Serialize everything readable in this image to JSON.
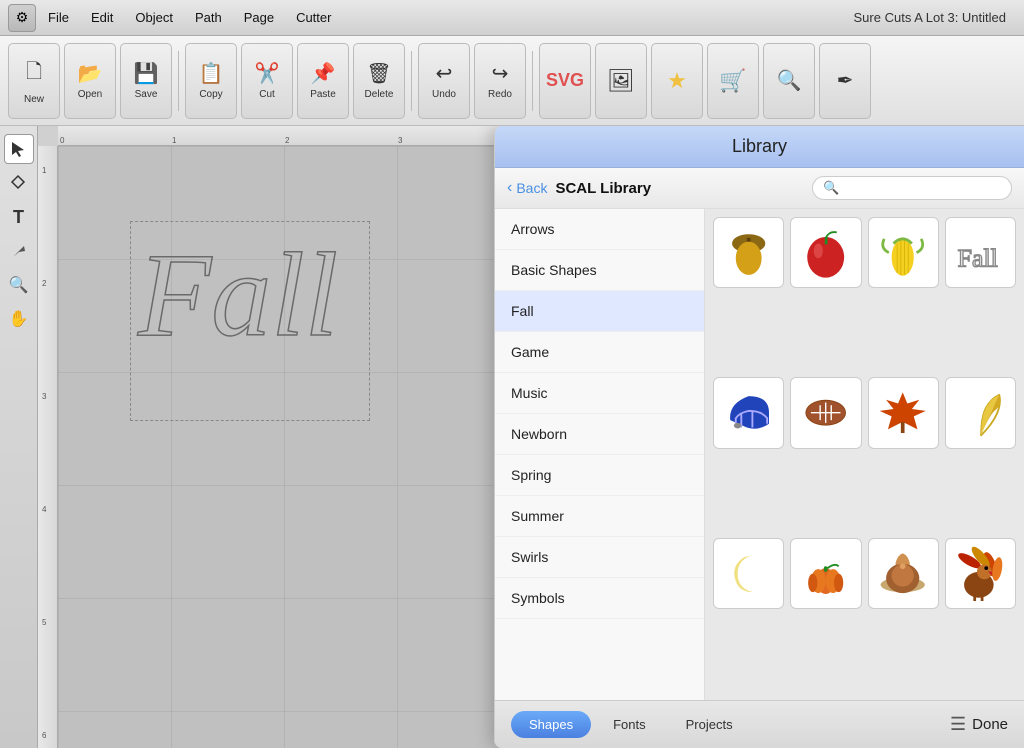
{
  "app": {
    "title": "Sure Cuts A Lot 3: Untitled"
  },
  "menubar": {
    "items": [
      "File",
      "Edit",
      "Object",
      "Path",
      "Page",
      "Cutter"
    ]
  },
  "toolbar": {
    "buttons": [
      {
        "label": "New",
        "icon": "🗋"
      },
      {
        "label": "Open",
        "icon": "📂"
      },
      {
        "label": "Save",
        "icon": "💾"
      },
      {
        "label": "Copy",
        "icon": "📋"
      },
      {
        "label": "Cut",
        "icon": "✂️"
      },
      {
        "label": "Paste",
        "icon": "📌"
      },
      {
        "label": "Delete",
        "icon": "🗑"
      },
      {
        "label": "Undo",
        "icon": "↩"
      },
      {
        "label": "Redo",
        "icon": "↪"
      }
    ]
  },
  "library": {
    "title": "Library",
    "back_label": "Back",
    "section_title": "SCAL Library",
    "search_placeholder": "",
    "categories": [
      {
        "id": "arrows",
        "label": "Arrows",
        "active": false
      },
      {
        "id": "basic-shapes",
        "label": "Basic Shapes",
        "active": false
      },
      {
        "id": "fall",
        "label": "Fall",
        "active": true
      },
      {
        "id": "game",
        "label": "Game",
        "active": false
      },
      {
        "id": "music",
        "label": "Music",
        "active": false
      },
      {
        "id": "newborn",
        "label": "Newborn",
        "active": false
      },
      {
        "id": "spring",
        "label": "Spring",
        "active": false
      },
      {
        "id": "summer",
        "label": "Summer",
        "active": false
      },
      {
        "id": "swirls",
        "label": "Swirls",
        "active": false
      },
      {
        "id": "symbols",
        "label": "Symbols",
        "active": false
      }
    ],
    "footer_tabs": [
      {
        "id": "shapes",
        "label": "Shapes",
        "active": true
      },
      {
        "id": "fonts",
        "label": "Fonts",
        "active": false
      },
      {
        "id": "projects",
        "label": "Projects",
        "active": false
      }
    ],
    "done_label": "Done"
  }
}
